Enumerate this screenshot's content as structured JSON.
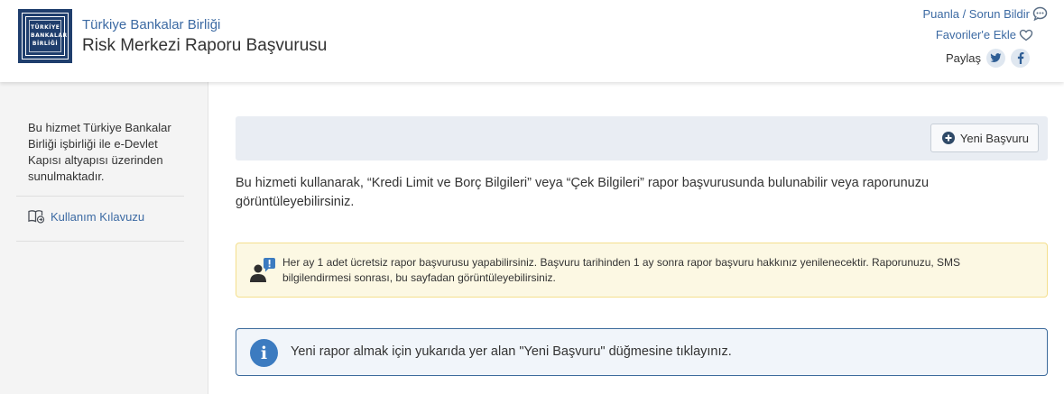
{
  "header": {
    "logo_lines": [
      "TÜRKİYE",
      "BANKALAR",
      "BİRLİĞİ"
    ],
    "org_name": "Türkiye Bankalar Birliği",
    "title": "Risk Merkezi Raporu Başvurusu",
    "feedback_label": "Puanla / Sorun Bildir",
    "favorites_label": "Favoriler'e Ekle",
    "share_label": "Paylaş",
    "icons": [
      "chat-bubble-icon",
      "heart-icon",
      "twitter-icon",
      "facebook-icon"
    ]
  },
  "sidebar": {
    "description": "Bu hizmet Türkiye Bankalar Birliği işbirliği ile e-Devlet Kapısı altyapısı üzerinden sunulmaktadır.",
    "guide_label": "Kullanım Kılavuzu"
  },
  "main": {
    "new_application_label": "Yeni Başvuru",
    "intro_text": "Bu hizmeti kullanarak, “Kredi Limit ve Borç Bilgileri” veya “Çek Bilgileri” rapor başvurusunda bulunabilir veya raporunuzu görüntüleyebilirsiniz.",
    "notice_text": "Her ay 1 adet ücretsiz rapor başvurusu yapabilirsiniz. Başvuru tarihinden 1 ay sonra rapor başvuru hakkınız yenilenecektir. Raporunuzu, SMS bilgilendirmesi sonrası, bu sayfadan görüntüleyebilirsiniz.",
    "info_text": "Yeni rapor almak için yukarıda yer alan \"Yeni Başvuru\" düğmesine tıklayınız."
  },
  "colors": {
    "link": "#3c6aa3",
    "logo": "#1f3e6d",
    "notice_bg": "#fcf8e3",
    "info_border": "#3d6b9c",
    "info_icon": "#3c7bc0"
  }
}
